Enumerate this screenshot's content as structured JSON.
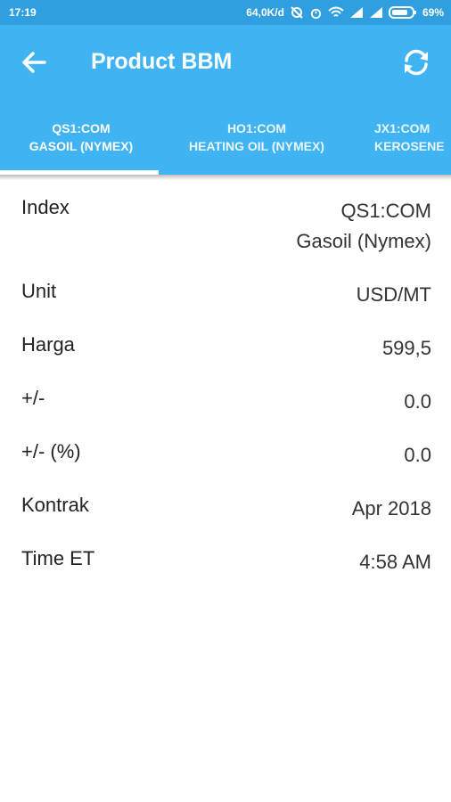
{
  "status": {
    "time": "17:19",
    "speed": "64,0K/d",
    "battery": "69%"
  },
  "appbar": {
    "title": "Product BBM",
    "back_icon": "arrow-back-icon",
    "refresh_icon": "refresh-icon"
  },
  "tabs": [
    {
      "code": "QS1:COM",
      "name": "GASOIL (NYMEX)"
    },
    {
      "code": "HO1:COM",
      "name": "HEATING OIL (NYMEX)"
    },
    {
      "code": "JX1:COM",
      "name": "KEROSENE"
    }
  ],
  "rows": [
    {
      "label": "Index",
      "value": "QS1:COM",
      "value2": "Gasoil (Nymex)"
    },
    {
      "label": "Unit",
      "value": "USD/MT"
    },
    {
      "label": "Harga",
      "value": "599,5"
    },
    {
      "label": "+/-",
      "value": "0.0"
    },
    {
      "label": "+/- (%)",
      "value": "0.0"
    },
    {
      "label": "Kontrak",
      "value": "Apr 2018"
    },
    {
      "label": "Time ET",
      "value": "4:58 AM"
    }
  ],
  "colors": {
    "appbar": "#40b3f2",
    "statusbar": "#2f9fe0"
  }
}
